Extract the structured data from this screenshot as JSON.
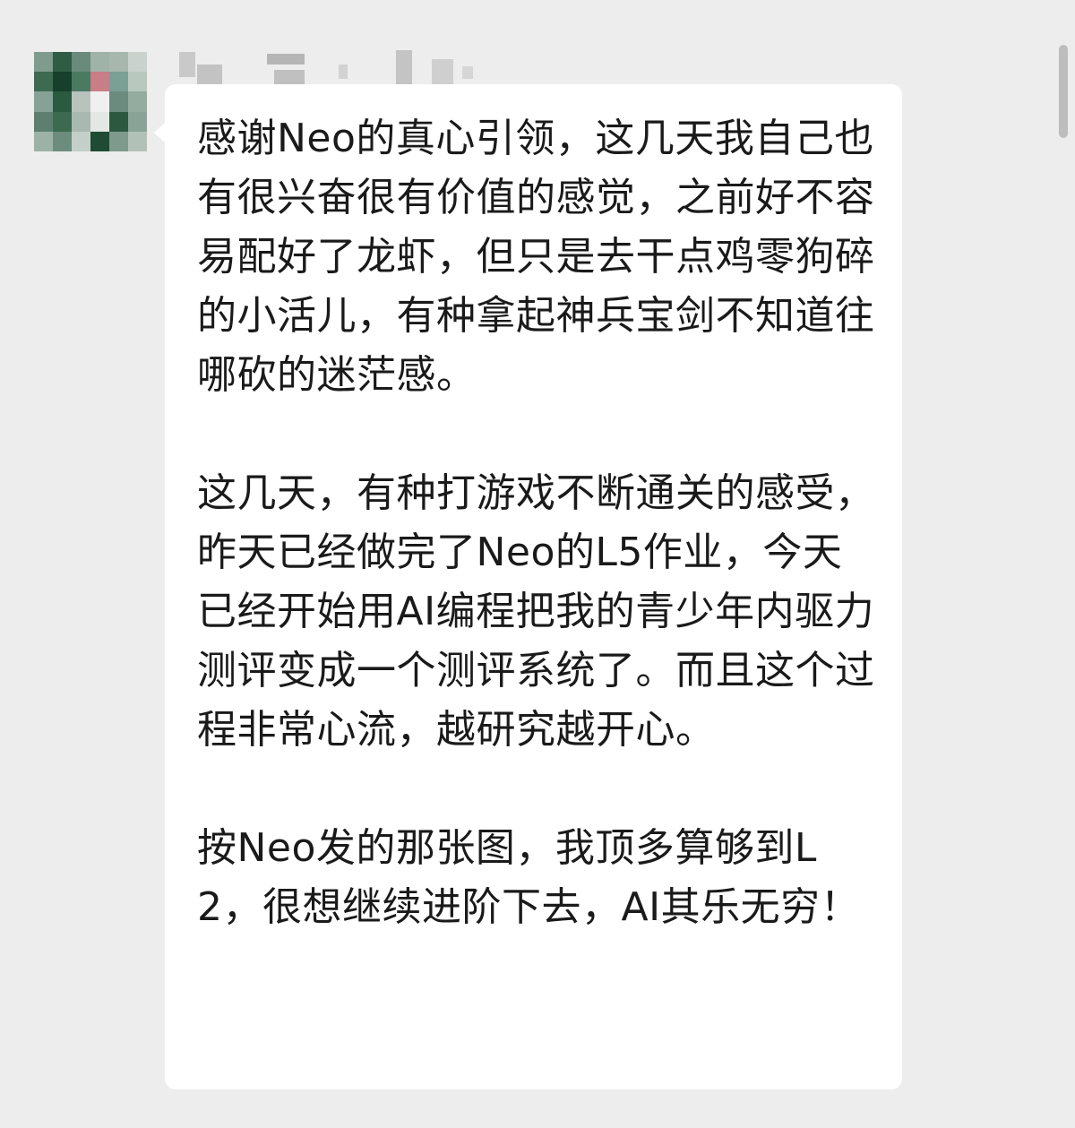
{
  "chat": {
    "sender_name": "",
    "message": {
      "paragraphs": [
        "感谢Neo的真心引领，这几天我自己也有很兴奋很有价值的感觉，之前好不容易配好了龙虾，但只是去干点鸡零狗碎的小活儿，有种拿起神兵宝剑不知道往哪砍的迷茫感。",
        "这几天，有种打游戏不断通关的感受，昨天已经做完了Neo的L5作业，今天已经开始用AI编程把我的青少年内驱力测评变成一个测评系统了。而且这个过程非常心流，越研究越开心。",
        "按Neo发的那张图，我顶多算够到L2，很想继续进阶下去，AI其乐无穷！"
      ]
    }
  },
  "colors": {
    "background": "#ededed",
    "bubble": "#ffffff",
    "text": "#1a1a1a"
  },
  "avatar_pixels": [
    "#7f9b8e",
    "#2f5c44",
    "#6a8a7b",
    "#9fb3a8",
    "#a7b7ae",
    "#c9d2cc",
    "#3e6a52",
    "#16402b",
    "#4b7a62",
    "#c97d86",
    "#7aa096",
    "#b9c8bf",
    "#86a296",
    "#2a5a3f",
    "#b8c3bd",
    "#f0f0f0",
    "#6b8b7f",
    "#94ab9f",
    "#5d7f6f",
    "#3b6a50",
    "#a9b8b0",
    "#e4e8e5",
    "#2c5840",
    "#8aa397",
    "#9db2a7",
    "#6c8c7e",
    "#c3cfc8",
    "#1f4a33",
    "#7e9a8d",
    "#b2c1b8"
  ],
  "icons": {
    "avatar": "pixelated-avatar",
    "bubble_tail": "chat-bubble-tail"
  }
}
